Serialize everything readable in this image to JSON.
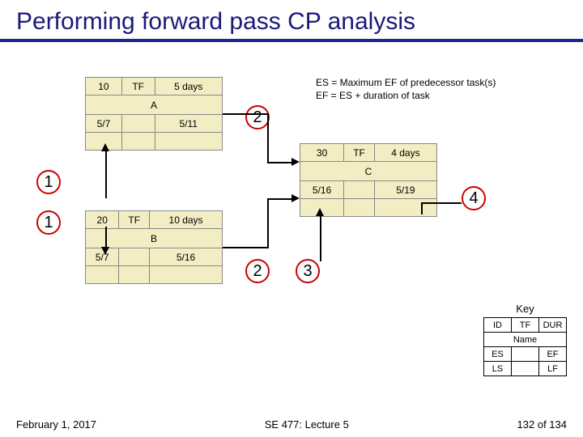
{
  "title": "Performing forward pass CP analysis",
  "formula": {
    "line1": "ES = Maximum EF of predecessor task(s)",
    "line2": "EF = ES + duration of task"
  },
  "tasks": {
    "A": {
      "id": "10",
      "tf": "TF",
      "dur": "5 days",
      "name": "A",
      "es": "5/7",
      "ef": "5/11",
      "ls": "",
      "lf": ""
    },
    "B": {
      "id": "20",
      "tf": "TF",
      "dur": "10 days",
      "name": "B",
      "es": "5/7",
      "ef": "5/16",
      "ls": "",
      "lf": ""
    },
    "C": {
      "id": "30",
      "tf": "TF",
      "dur": "4 days",
      "name": "C",
      "es": "5/16",
      "ef": "5/19",
      "ls": "",
      "lf": ""
    }
  },
  "circles": {
    "n1a": "1",
    "n1b": "1",
    "n2a": "2",
    "n2b": "2",
    "n3": "3",
    "n4": "4"
  },
  "key": {
    "title": "Key",
    "r1c1": "ID",
    "r1c2": "TF",
    "r1c3": "DUR",
    "r2": "Name",
    "r3c1": "ES",
    "r3c2": "EF",
    "r4c1": "LS",
    "r4c2": "LF"
  },
  "footer": {
    "date": "February 1, 2017",
    "center": "SE 477: Lecture 5",
    "page": "132 of 134"
  }
}
